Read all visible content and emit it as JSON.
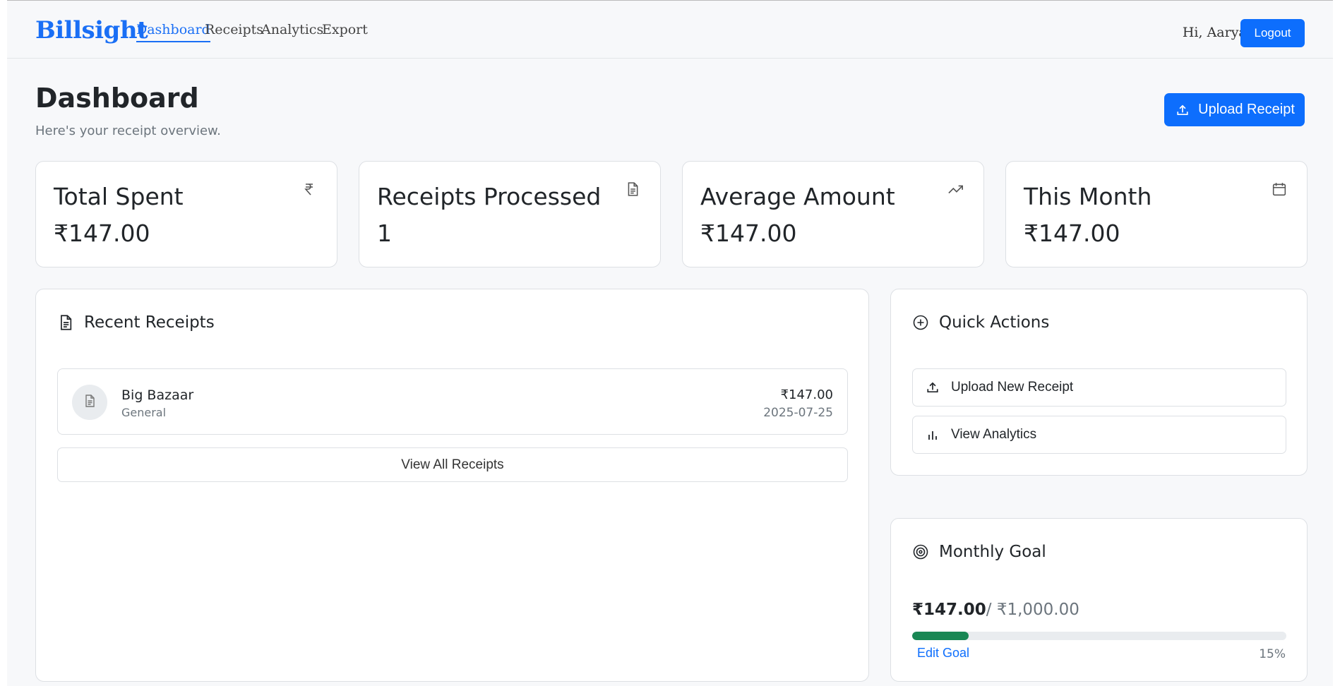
{
  "nav": {
    "brand": "Billsight",
    "links": [
      {
        "label": "Dashboard",
        "active": true
      },
      {
        "label": "Receipts",
        "active": false
      },
      {
        "label": "Analytics",
        "active": false
      },
      {
        "label": "Export",
        "active": false
      }
    ],
    "greeting": "Hi, Aaryan",
    "logout_label": "Logout"
  },
  "header": {
    "title": "Dashboard",
    "subtitle": "Here's your receipt overview.",
    "upload_label": "Upload Receipt"
  },
  "stats": [
    {
      "title": "Total Spent",
      "value": "₹147.00",
      "icon": "rupee-icon"
    },
    {
      "title": "Receipts Processed",
      "value": "1",
      "icon": "document-icon"
    },
    {
      "title": "Average Amount",
      "value": "₹147.00",
      "icon": "trending-up-icon"
    },
    {
      "title": "This Month",
      "value": "₹147.00",
      "icon": "calendar-icon"
    }
  ],
  "recent": {
    "title": "Recent Receipts",
    "items": [
      {
        "name": "Big Bazaar",
        "category": "General",
        "amount": "₹147.00",
        "date": "2025-07-25"
      }
    ],
    "view_all_label": "View All Receipts"
  },
  "quick_actions": {
    "title": "Quick Actions",
    "upload_label": "Upload New Receipt",
    "analytics_label": "View Analytics"
  },
  "goal": {
    "title": "Monthly Goal",
    "spent": "₹147.00",
    "target": "/ ₹1,000.00",
    "progress": 0.15,
    "percent_label": "15%",
    "edit_label": "Edit Goal"
  },
  "colors": {
    "primary": "#0d6efd",
    "brand": "#1a6ff5",
    "progress": "#198754"
  }
}
